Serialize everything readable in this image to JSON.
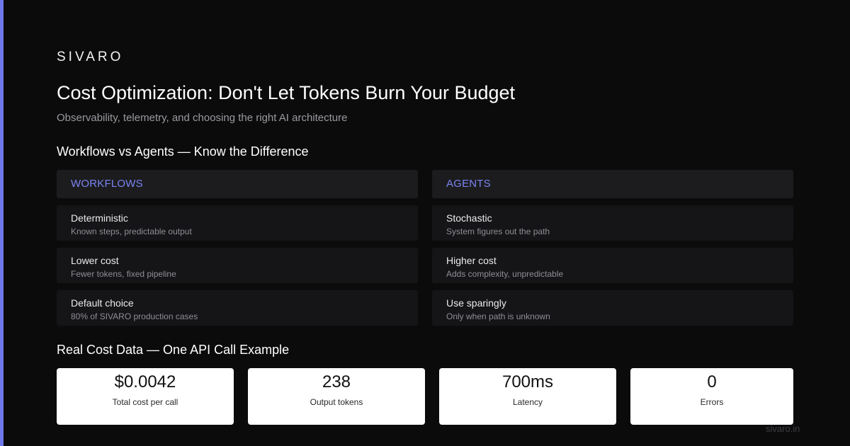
{
  "theme": {
    "background": "#0b0b0c",
    "accent": "#7b84f0",
    "accent_bar": "#6f78e8",
    "panel": "#151518",
    "panel_header": "#1c1c1f",
    "card": "#ffffff"
  },
  "brand": "SIVARO",
  "title": "Cost Optimization: Don't Let Tokens Burn Your Budget",
  "subtitle": "Observability, telemetry, and choosing the right AI architecture",
  "comparison": {
    "heading": "Workflows vs Agents — Know the Difference",
    "workflows": {
      "label": "WORKFLOWS",
      "items": [
        {
          "title": "Deterministic",
          "desc": "Known steps, predictable output"
        },
        {
          "title": "Lower cost",
          "desc": "Fewer tokens, fixed pipeline"
        },
        {
          "title": "Default choice",
          "desc": "80% of SIVARO production cases"
        }
      ]
    },
    "agents": {
      "label": "AGENTS",
      "items": [
        {
          "title": "Stochastic",
          "desc": "System figures out the path"
        },
        {
          "title": "Higher cost",
          "desc": "Adds complexity, unpredictable"
        },
        {
          "title": "Use sparingly",
          "desc": "Only when path is unknown"
        }
      ]
    }
  },
  "cost_data": {
    "heading": "Real Cost Data — One API Call Example",
    "metrics": [
      {
        "value": "$0.0042",
        "label": "Total cost per call"
      },
      {
        "value": "238",
        "label": "Output tokens"
      },
      {
        "value": "700ms",
        "label": "Latency"
      },
      {
        "value": "0",
        "label": "Errors"
      }
    ]
  },
  "footer": "sivaro.in"
}
